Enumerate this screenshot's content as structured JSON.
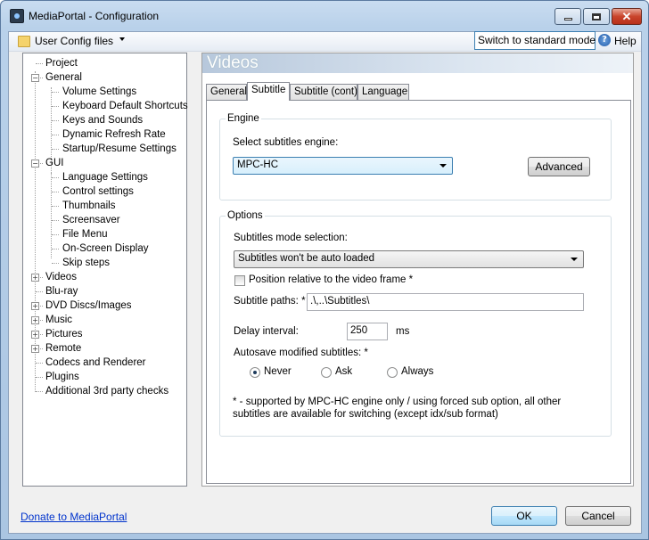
{
  "window": {
    "title": "MediaPortal - Configuration"
  },
  "toolbar": {
    "user_config": "User Config files",
    "switch_mode": "Switch to standard mode",
    "help": "Help"
  },
  "tree": {
    "items": [
      "Project",
      "General",
      "Volume Settings",
      "Keyboard Default Shortcuts",
      "Keys and Sounds",
      "Dynamic Refresh Rate",
      "Startup/Resume Settings",
      "GUI",
      "Language Settings",
      "Control settings",
      "Thumbnails",
      "Screensaver",
      "File Menu",
      "On-Screen Display",
      "Skip steps",
      "Videos",
      "Blu-ray",
      "DVD Discs/Images",
      "Music",
      "Pictures",
      "Remote",
      "Codecs and Renderer",
      "Plugins",
      "Additional 3rd party checks"
    ],
    "expander_collapsed": "+",
    "expander_expanded": "−"
  },
  "panel": {
    "header": "Videos",
    "tabs": [
      "General",
      "Subtitle",
      "Subtitle (cont)",
      "Language"
    ],
    "engine": {
      "legend": "Engine",
      "select_label": "Select subtitles engine:",
      "selected": "MPC-HC",
      "advanced": "Advanced"
    },
    "options": {
      "legend": "Options",
      "mode_label": "Subtitles mode selection:",
      "mode_selected": "Subtitles won't be auto loaded",
      "position_label": "Position relative to the video frame *",
      "paths_label": "Subtitle paths: *",
      "paths_value": ".\\,..\\Subtitles\\",
      "delay_label": "Delay interval:",
      "delay_value": "250",
      "delay_unit": "ms",
      "autosave_label": "Autosave modified subtitles: *",
      "radio_never": "Never",
      "radio_ask": "Ask",
      "radio_always": "Always",
      "note": "* - supported by MPC-HC engine only / using forced sub option, all other subtitles are available for switching (except idx/sub format)"
    }
  },
  "footer": {
    "donate": "Donate to MediaPortal",
    "ok": "OK",
    "cancel": "Cancel"
  },
  "icons": {
    "app": "mediaportal-app-icon",
    "folder": "folder-icon",
    "help": "help-icon"
  }
}
